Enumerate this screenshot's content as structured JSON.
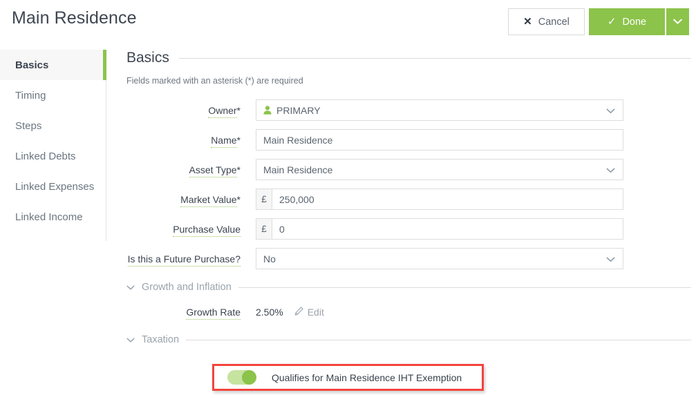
{
  "header": {
    "title": "Main Residence",
    "cancel_label": "Cancel",
    "cancel_icon": "close-icon",
    "done_label": "Done",
    "done_icon": "check-icon",
    "done_caret_icon": "chevron-down-icon",
    "accent_green": "#8cc34b"
  },
  "sidebar": {
    "items": [
      {
        "label": "Basics",
        "active": true
      },
      {
        "label": "Timing",
        "active": false
      },
      {
        "label": "Steps",
        "active": false
      },
      {
        "label": "Linked Debts",
        "active": false
      },
      {
        "label": "Linked Expenses",
        "active": false
      },
      {
        "label": "Linked Income",
        "active": false
      }
    ]
  },
  "main": {
    "section_title": "Basics",
    "required_hint": "Fields marked with an asterisk (*) are required",
    "fields": {
      "owner": {
        "label": "Owner",
        "required_mark": "*",
        "value": "PRIMARY",
        "icon": "person-icon",
        "caret": "chevron-down-icon"
      },
      "name": {
        "label": "Name",
        "required_mark": "*",
        "value": "Main Residence"
      },
      "asset_type": {
        "label": "Asset Type",
        "required_mark": "*",
        "value": "Main Residence",
        "caret": "chevron-down-icon"
      },
      "market_value": {
        "label": "Market Value",
        "required_mark": "*",
        "currency": "£",
        "value": "250,000"
      },
      "purchase_value": {
        "label": "Purchase Value",
        "required_mark": "",
        "currency": "£",
        "value": "0"
      },
      "future_purchase": {
        "label": "Is this a Future Purchase?",
        "required_mark": "",
        "value": "No",
        "caret": "chevron-down-icon"
      }
    },
    "growth_section": {
      "title": "Growth and Inflation",
      "caret": "chevron-down-icon",
      "growth_rate_label": "Growth Rate",
      "growth_rate_value": "2.50%",
      "edit_label": "Edit",
      "edit_icon": "pencil-icon"
    },
    "taxation_section": {
      "title": "Taxation",
      "caret": "chevron-down-icon",
      "toggle_label": "Qualifies for Main Residence IHT Exemption",
      "toggle_state": "on",
      "highlight_color": "#f4443c"
    }
  }
}
